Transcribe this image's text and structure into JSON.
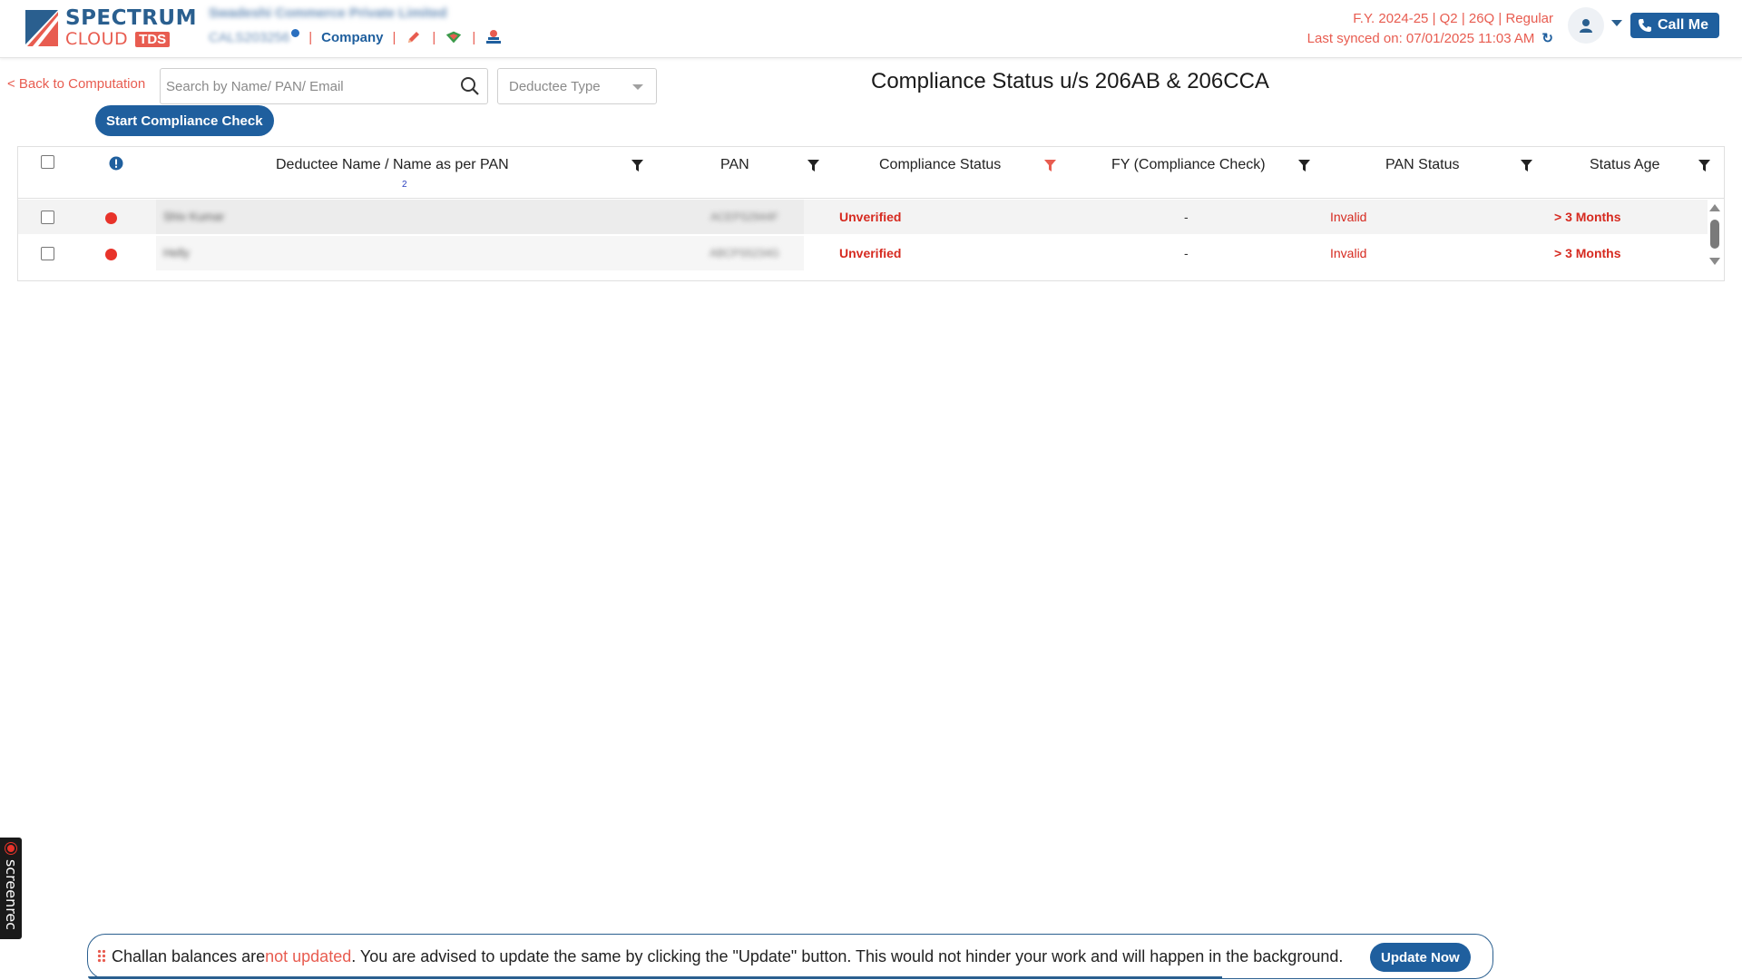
{
  "header": {
    "logo_primary": "SPECTRUM",
    "logo_secondary": "CLOUD",
    "logo_badge": "TDS",
    "company_name": "Swadeshi Commerce Private Limited",
    "company_code": "CALS203256",
    "company_link": "Company",
    "separator": "|",
    "fy_line": "F.Y. 2024-25  | Q2  | 26Q | Regular",
    "sync_line": "Last synced on: 07/01/2025 11:03 AM",
    "call_label": "Call Me"
  },
  "toolbar": {
    "back_label": "< Back to Computation",
    "search_placeholder": "Search by Name/ PAN/ Email",
    "deductee_type_placeholder": "Deductee Type",
    "title": "Compliance Status u/s 206AB & 206CCA",
    "start_button": "Start Compliance Check"
  },
  "table": {
    "columns": [
      "Deductee Name / Name as per PAN",
      "PAN",
      "Compliance Status",
      "FY (Compliance Check)",
      "PAN Status",
      "Status Age"
    ],
    "sort_index": "2",
    "rows": [
      {
        "name": "Shiv Kumar",
        "pan": "ACEPS2944F",
        "compliance_status": "Unverified",
        "fy": "-",
        "pan_status": "Invalid",
        "status_age": "> 3 Months"
      },
      {
        "name": "Helly",
        "pan": "ABCPS5234G",
        "compliance_status": "Unverified",
        "fy": "-",
        "pan_status": "Invalid",
        "status_age": "> 3 Months"
      }
    ]
  },
  "screenrec": {
    "label": "screenrec"
  },
  "banner": {
    "text_before": "Challan balances are ",
    "text_highlight": "not updated",
    "text_after": ". You are advised to update the same by clicking the \"Update\" button. This would not hinder your work and will happen in the background.",
    "button": "Update Now"
  },
  "colors": {
    "brand_blue": "#1f5f9e",
    "accent_red": "#e85c50",
    "status_red": "#d62a20"
  }
}
